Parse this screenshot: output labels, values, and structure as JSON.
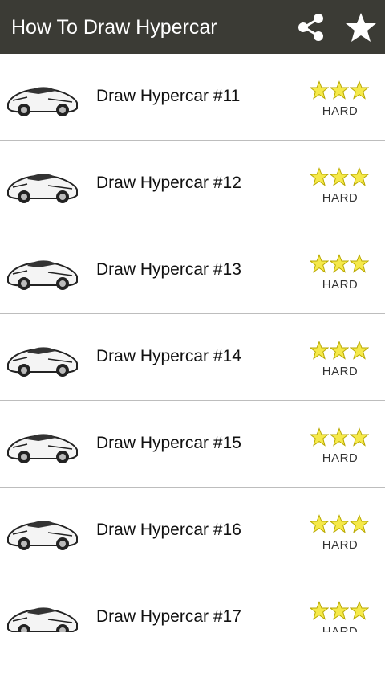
{
  "appbar": {
    "title": "How To Draw Hypercar",
    "share_icon": "share-icon",
    "star_icon": "star-icon",
    "background": "#3b3b35"
  },
  "items": [
    {
      "label": "Draw Hypercar #11",
      "difficulty": "HARD",
      "stars": 3
    },
    {
      "label": "Draw Hypercar #12",
      "difficulty": "HARD",
      "stars": 3
    },
    {
      "label": "Draw Hypercar #13",
      "difficulty": "HARD",
      "stars": 3
    },
    {
      "label": "Draw Hypercar #14",
      "difficulty": "HARD",
      "stars": 3
    },
    {
      "label": "Draw Hypercar #15",
      "difficulty": "HARD",
      "stars": 3
    },
    {
      "label": "Draw Hypercar #16",
      "difficulty": "HARD",
      "stars": 3
    },
    {
      "label": "Draw Hypercar #17",
      "difficulty": "HARD",
      "stars": 3
    }
  ],
  "colors": {
    "star_fill": "#f5e94a",
    "star_stroke": "#b8a800"
  }
}
